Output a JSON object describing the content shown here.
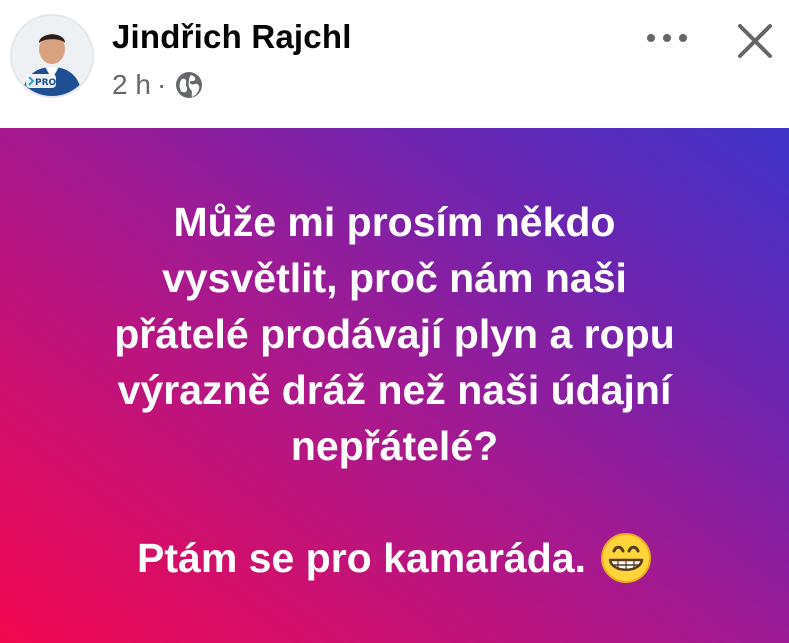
{
  "post": {
    "author": {
      "name": "Jindřich Rajchl",
      "avatar_badge": "PRO"
    },
    "meta": {
      "time": "2 h",
      "separator": "·",
      "privacy_icon": "globe-icon"
    },
    "actions": {
      "more_icon": "more-horizontal-icon",
      "close_icon": "close-icon"
    },
    "body": {
      "background_colors": [
        "#f2074f",
        "#a21a92",
        "#3f33c9"
      ],
      "text_color": "#ffffff",
      "lines": [
        "Může mi prosím někdo",
        "vysvětlit, proč nám naši",
        "přátelé prodávají plyn a ropu",
        "výrazně dráž než naši údajní",
        "nepřátelé?"
      ],
      "closing_line": "Ptám se pro kamaráda.",
      "closing_emoji": "grinning-face-emoji"
    }
  }
}
